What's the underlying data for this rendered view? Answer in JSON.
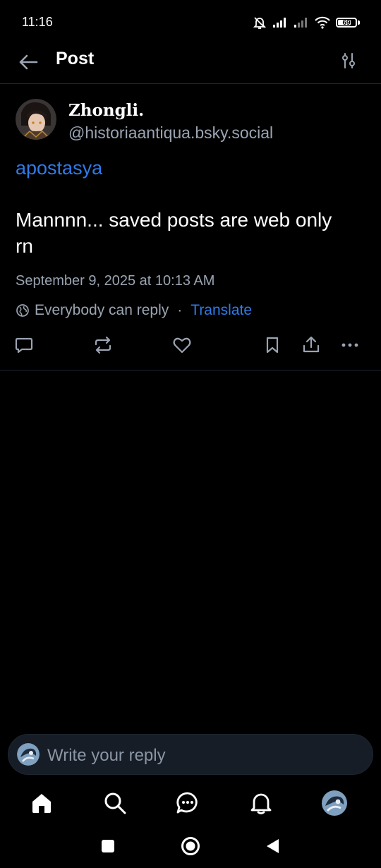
{
  "status_bar": {
    "time": "11:16",
    "battery": "69"
  },
  "header": {
    "title": "Post"
  },
  "post": {
    "display_name": "Zhongli.",
    "handle": "@historiaantiqua.bsky.social",
    "mention": "apostasya",
    "text": "Mannnn... saved posts are web only rn",
    "timestamp": "September 9, 2025 at 10:13 AM",
    "reply_setting": "Everybody can reply",
    "separator": "·",
    "translate": "Translate"
  },
  "reply": {
    "placeholder": "Write your reply"
  },
  "colors": {
    "accent": "#2f7be8",
    "muted": "#9aa4b2",
    "background": "#000000",
    "input_bg": "#161d26"
  },
  "icons": {
    "post_actions": [
      "reply-icon",
      "repost-icon",
      "like-icon",
      "bookmark-icon",
      "share-icon",
      "more-icon"
    ],
    "bottom_nav": [
      "home-icon",
      "search-icon",
      "chat-icon",
      "notifications-icon",
      "profile-avatar"
    ],
    "system_nav": [
      "recents-icon",
      "home-circle-icon",
      "back-triangle-icon"
    ]
  }
}
